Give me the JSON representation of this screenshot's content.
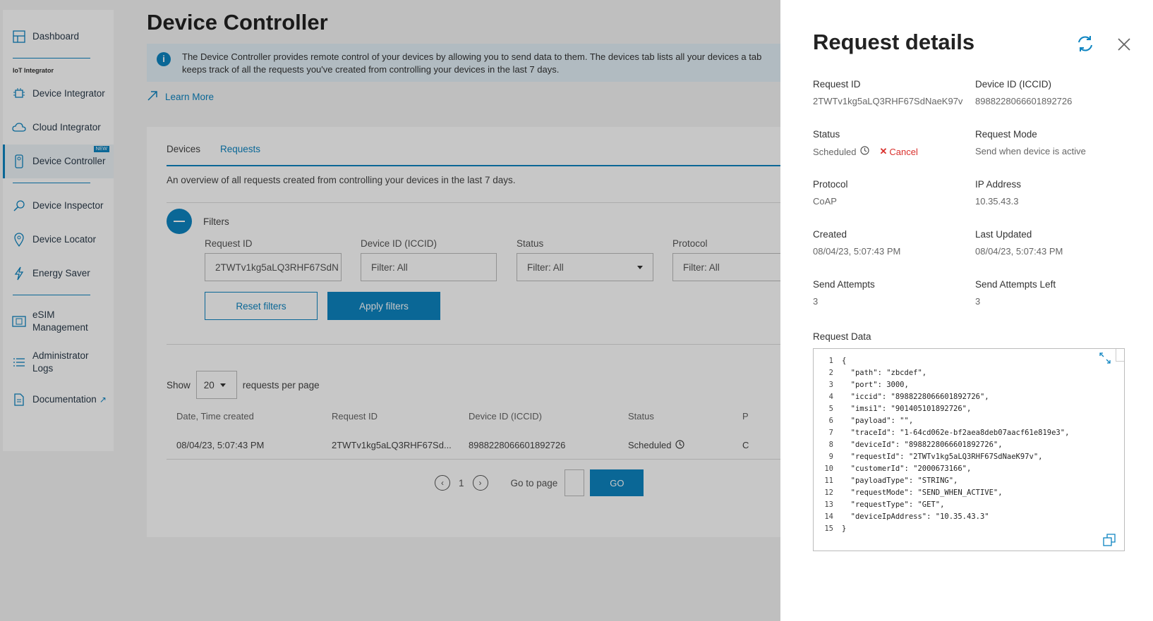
{
  "sidebar": {
    "section_label": "IoT Integrator",
    "new_badge": "NEW",
    "items": [
      {
        "label": "Dashboard"
      },
      {
        "label": "Device Integrator"
      },
      {
        "label": "Cloud Integrator"
      },
      {
        "label": "Device Controller"
      },
      {
        "label": "Device Inspector"
      },
      {
        "label": "Device Locator"
      },
      {
        "label": "Energy Saver"
      },
      {
        "label": "eSIM\nManagement"
      },
      {
        "label": "Administrator\nLogs"
      },
      {
        "label": "Documentation"
      }
    ]
  },
  "main": {
    "title": "Device Controller",
    "info_text": "The Device Controller provides remote control of your devices by allowing you to send data to them. The devices tab lists all your devices a tab keeps track of all the requests you've created from controlling your devices in the last 7 days.",
    "learn_more": "Learn More",
    "tabs": [
      {
        "label": "Devices"
      },
      {
        "label": "Requests"
      }
    ],
    "overview_text": "An overview of all requests created from controlling your devices in the last 7 days.",
    "filters_label": "Filters",
    "filters": {
      "request_id_label": "Request ID",
      "request_id_value": "2TWTv1kg5aLQ3RHF67SdN",
      "device_id_label": "Device ID (ICCID)",
      "device_id_placeholder": "Filter: All",
      "status_label": "Status",
      "status_value": "Filter: All",
      "protocol_label": "Protocol",
      "protocol_value": "Filter: All"
    },
    "reset_filters": "Reset filters",
    "apply_filters": "Apply filters",
    "show_label": "Show",
    "per_page_value": "20",
    "per_page_label": "requests per page",
    "table": {
      "headers": [
        "Date, Time created",
        "Request ID",
        "Device ID (ICCID)",
        "Status",
        "P"
      ],
      "rows": [
        {
          "created": "08/04/23, 5:07:43 PM",
          "request_id": "2TWTv1kg5aLQ3RHF67Sd...",
          "device_id": "8988228066601892726",
          "status": "Scheduled",
          "protocol": "C"
        }
      ]
    },
    "pager": {
      "page": "1",
      "goto_label": "Go to page",
      "go_button": "GO"
    }
  },
  "drawer": {
    "title": "Request details",
    "fields": {
      "request_id_k": "Request ID",
      "request_id_v": "2TWTv1kg5aLQ3RHF67SdNaeK97v",
      "device_id_k": "Device ID (ICCID)",
      "device_id_v": "8988228066601892726",
      "status_k": "Status",
      "status_v": "Scheduled",
      "cancel": "Cancel",
      "mode_k": "Request Mode",
      "mode_v": "Send when device is active",
      "protocol_k": "Protocol",
      "protocol_v": "CoAP",
      "ip_k": "IP Address",
      "ip_v": "10.35.43.3",
      "created_k": "Created",
      "created_v": "08/04/23, 5:07:43 PM",
      "updated_k": "Last Updated",
      "updated_v": "08/04/23, 5:07:43 PM",
      "attempts_k": "Send Attempts",
      "attempts_v": "3",
      "attempts_left_k": "Send Attempts Left",
      "attempts_left_v": "3"
    },
    "request_data_label": "Request Data",
    "code_lines": [
      "{",
      "  \"path\": \"zbcdef\",",
      "  \"port\": 3000,",
      "  \"iccid\": \"8988228066601892726\",",
      "  \"imsi1\": \"901405101892726\",",
      "  \"payload\": \"\",",
      "  \"traceId\": \"1-64cd062e-bf2aea8deb07aacf61e819e3\",",
      "  \"deviceId\": \"8988228066601892726\",",
      "  \"requestId\": \"2TWTv1kg5aLQ3RHF67SdNaeK97v\",",
      "  \"customerId\": \"2000673166\",",
      "  \"payloadType\": \"STRING\",",
      "  \"requestMode\": \"SEND_WHEN_ACTIVE\",",
      "  \"requestType\": \"GET\",",
      "  \"deviceIpAddress\": \"10.35.43.3\"",
      "}"
    ]
  },
  "colors": {
    "accent": "#0d84c1",
    "cancel": "#d9302c",
    "overlay": "rgba(0,0,0,0.22)"
  }
}
